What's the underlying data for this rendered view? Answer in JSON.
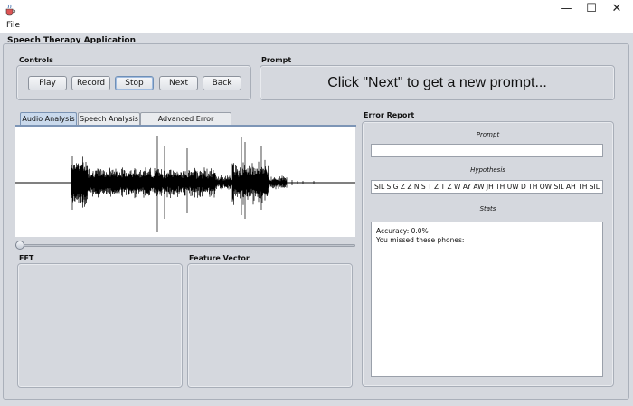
{
  "menu": {
    "file": "File"
  },
  "app": {
    "title": "Speech Therapy Application"
  },
  "controls": {
    "title": "Controls",
    "play": "Play",
    "record": "Record",
    "stop": "Stop",
    "next": "Next",
    "back": "Back"
  },
  "prompt": {
    "title": "Prompt",
    "text": "Click \"Next\" to get a new prompt..."
  },
  "tabs": [
    "Audio Analysis",
    "Speech Analysis",
    "Advanced Error Reporting"
  ],
  "panels": {
    "fft": "FFT",
    "feature_vector": "Feature Vector"
  },
  "error_report": {
    "title": "Error Report",
    "prompt_label": "Prompt",
    "prompt_value": "",
    "hypothesis_label": "Hypothesis",
    "hypothesis_value": "SIL S G Z Z N S T Z T Z W AY AW JH TH UW D TH OW SIL AH TH SIL M",
    "stats_label": "Stats",
    "stats_line1": "Accuracy: 0.0%",
    "stats_line2": "You missed these phones:"
  },
  "icons": {
    "app": "java-cup-icon",
    "minimize": "minimize-icon",
    "maximize": "maximize-icon",
    "close": "close-icon"
  },
  "window_controls": {
    "minimize": "—",
    "maximize": "☐",
    "close": "✕"
  },
  "slider": {
    "position": 0
  }
}
